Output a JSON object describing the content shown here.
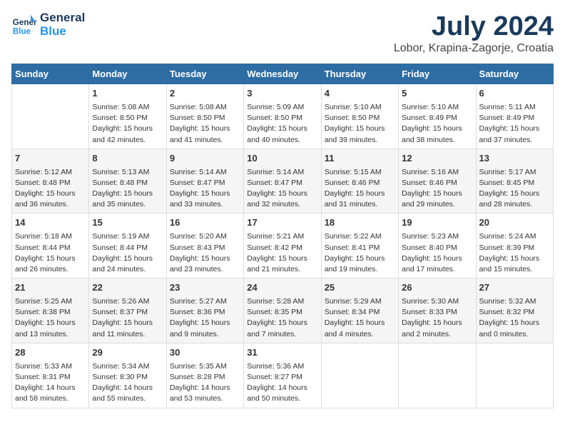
{
  "header": {
    "logo_line1": "General",
    "logo_line2": "Blue",
    "month_title": "July 2024",
    "location": "Lobor, Krapina-Zagorje, Croatia"
  },
  "columns": [
    "Sunday",
    "Monday",
    "Tuesday",
    "Wednesday",
    "Thursday",
    "Friday",
    "Saturday"
  ],
  "weeks": [
    {
      "days": [
        {
          "num": "",
          "text": ""
        },
        {
          "num": "1",
          "text": "Sunrise: 5:08 AM\nSunset: 8:50 PM\nDaylight: 15 hours\nand 42 minutes."
        },
        {
          "num": "2",
          "text": "Sunrise: 5:08 AM\nSunset: 8:50 PM\nDaylight: 15 hours\nand 41 minutes."
        },
        {
          "num": "3",
          "text": "Sunrise: 5:09 AM\nSunset: 8:50 PM\nDaylight: 15 hours\nand 40 minutes."
        },
        {
          "num": "4",
          "text": "Sunrise: 5:10 AM\nSunset: 8:50 PM\nDaylight: 15 hours\nand 39 minutes."
        },
        {
          "num": "5",
          "text": "Sunrise: 5:10 AM\nSunset: 8:49 PM\nDaylight: 15 hours\nand 38 minutes."
        },
        {
          "num": "6",
          "text": "Sunrise: 5:11 AM\nSunset: 8:49 PM\nDaylight: 15 hours\nand 37 minutes."
        }
      ]
    },
    {
      "days": [
        {
          "num": "7",
          "text": "Sunrise: 5:12 AM\nSunset: 8:48 PM\nDaylight: 15 hours\nand 36 minutes."
        },
        {
          "num": "8",
          "text": "Sunrise: 5:13 AM\nSunset: 8:48 PM\nDaylight: 15 hours\nand 35 minutes."
        },
        {
          "num": "9",
          "text": "Sunrise: 5:14 AM\nSunset: 8:47 PM\nDaylight: 15 hours\nand 33 minutes."
        },
        {
          "num": "10",
          "text": "Sunrise: 5:14 AM\nSunset: 8:47 PM\nDaylight: 15 hours\nand 32 minutes."
        },
        {
          "num": "11",
          "text": "Sunrise: 5:15 AM\nSunset: 8:46 PM\nDaylight: 15 hours\nand 31 minutes."
        },
        {
          "num": "12",
          "text": "Sunrise: 5:16 AM\nSunset: 8:46 PM\nDaylight: 15 hours\nand 29 minutes."
        },
        {
          "num": "13",
          "text": "Sunrise: 5:17 AM\nSunset: 8:45 PM\nDaylight: 15 hours\nand 28 minutes."
        }
      ]
    },
    {
      "days": [
        {
          "num": "14",
          "text": "Sunrise: 5:18 AM\nSunset: 8:44 PM\nDaylight: 15 hours\nand 26 minutes."
        },
        {
          "num": "15",
          "text": "Sunrise: 5:19 AM\nSunset: 8:44 PM\nDaylight: 15 hours\nand 24 minutes."
        },
        {
          "num": "16",
          "text": "Sunrise: 5:20 AM\nSunset: 8:43 PM\nDaylight: 15 hours\nand 23 minutes."
        },
        {
          "num": "17",
          "text": "Sunrise: 5:21 AM\nSunset: 8:42 PM\nDaylight: 15 hours\nand 21 minutes."
        },
        {
          "num": "18",
          "text": "Sunrise: 5:22 AM\nSunset: 8:41 PM\nDaylight: 15 hours\nand 19 minutes."
        },
        {
          "num": "19",
          "text": "Sunrise: 5:23 AM\nSunset: 8:40 PM\nDaylight: 15 hours\nand 17 minutes."
        },
        {
          "num": "20",
          "text": "Sunrise: 5:24 AM\nSunset: 8:39 PM\nDaylight: 15 hours\nand 15 minutes."
        }
      ]
    },
    {
      "days": [
        {
          "num": "21",
          "text": "Sunrise: 5:25 AM\nSunset: 8:38 PM\nDaylight: 15 hours\nand 13 minutes."
        },
        {
          "num": "22",
          "text": "Sunrise: 5:26 AM\nSunset: 8:37 PM\nDaylight: 15 hours\nand 11 minutes."
        },
        {
          "num": "23",
          "text": "Sunrise: 5:27 AM\nSunset: 8:36 PM\nDaylight: 15 hours\nand 9 minutes."
        },
        {
          "num": "24",
          "text": "Sunrise: 5:28 AM\nSunset: 8:35 PM\nDaylight: 15 hours\nand 7 minutes."
        },
        {
          "num": "25",
          "text": "Sunrise: 5:29 AM\nSunset: 8:34 PM\nDaylight: 15 hours\nand 4 minutes."
        },
        {
          "num": "26",
          "text": "Sunrise: 5:30 AM\nSunset: 8:33 PM\nDaylight: 15 hours\nand 2 minutes."
        },
        {
          "num": "27",
          "text": "Sunrise: 5:32 AM\nSunset: 8:32 PM\nDaylight: 15 hours\nand 0 minutes."
        }
      ]
    },
    {
      "days": [
        {
          "num": "28",
          "text": "Sunrise: 5:33 AM\nSunset: 8:31 PM\nDaylight: 14 hours\nand 58 minutes."
        },
        {
          "num": "29",
          "text": "Sunrise: 5:34 AM\nSunset: 8:30 PM\nDaylight: 14 hours\nand 55 minutes."
        },
        {
          "num": "30",
          "text": "Sunrise: 5:35 AM\nSunset: 8:28 PM\nDaylight: 14 hours\nand 53 minutes."
        },
        {
          "num": "31",
          "text": "Sunrise: 5:36 AM\nSunset: 8:27 PM\nDaylight: 14 hours\nand 50 minutes."
        },
        {
          "num": "",
          "text": ""
        },
        {
          "num": "",
          "text": ""
        },
        {
          "num": "",
          "text": ""
        }
      ]
    }
  ]
}
